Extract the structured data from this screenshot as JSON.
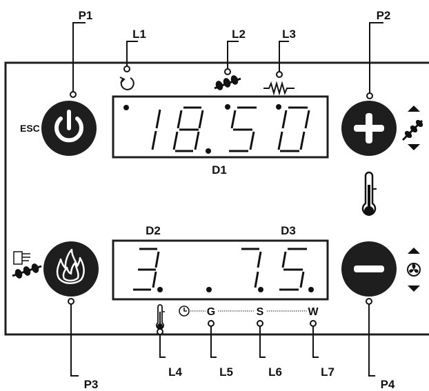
{
  "labels": {
    "p1": "P1",
    "p2": "P2",
    "p3": "P3",
    "p4": "P4",
    "l1": "L1",
    "l2": "L2",
    "l3": "L3",
    "l4": "L4",
    "l5": "L5",
    "l6": "L6",
    "l7": "L7",
    "d1": "D1",
    "d2": "D2",
    "d3": "D3"
  },
  "buttons": {
    "esc_label": "ESC"
  },
  "display_top": {
    "value": "18.50"
  },
  "display_bottom": {
    "left_value": "3.",
    "right_value": "7.5."
  },
  "led_row": {
    "g": "G",
    "s": "S",
    "w": "W"
  },
  "icons": {
    "p1": "power-icon",
    "p2": "plus-icon",
    "p3": "flame-icon",
    "p4": "minus-icon",
    "l1": "cycle-icon",
    "l2": "auger-icon",
    "l3": "resistor-icon",
    "l4": "thermometer-icon"
  },
  "colors": {
    "button": "#1e1e1e",
    "panel_border": "#1e1e1e",
    "background": "#ffffff"
  }
}
